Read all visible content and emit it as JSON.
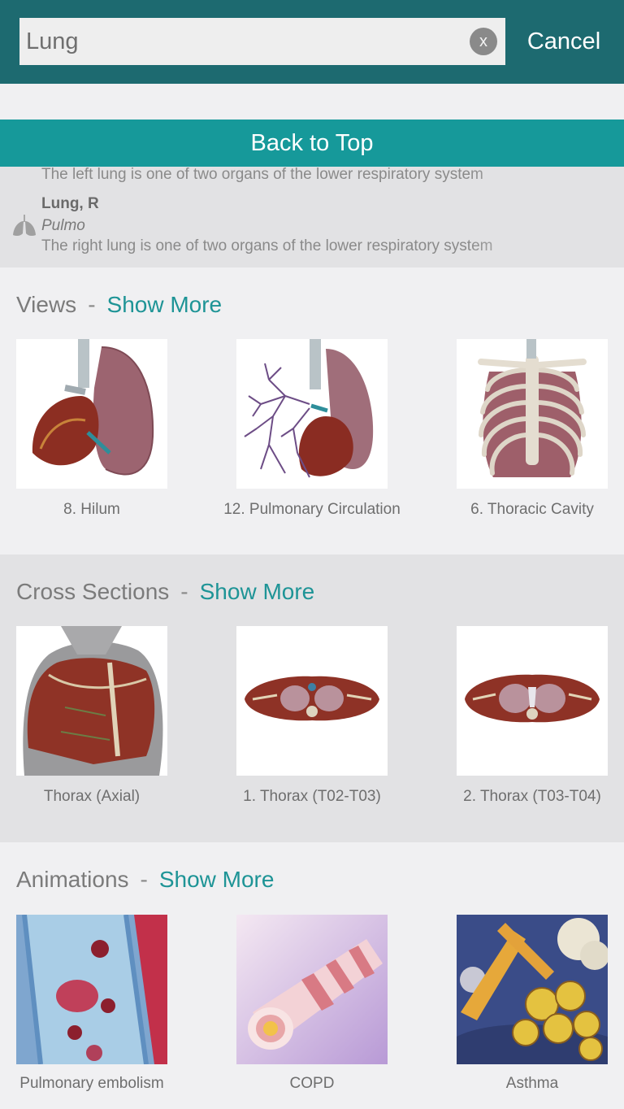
{
  "search": {
    "value": "Lung",
    "clear_label": "x",
    "cancel_label": "Cancel"
  },
  "back_to_top_label": "Back to Top",
  "results": [
    {
      "description": "The left lung is one of two organs of the lower respiratory system"
    },
    {
      "title": "Lung, R",
      "subtitle": "Pulmo",
      "description": "The right lung is one of two organs of the lower respiratory system"
    }
  ],
  "views": {
    "title": "Views",
    "separator": "-",
    "show_more": "Show More",
    "items": [
      {
        "caption": "8. Hilum",
        "icon": "hilum-thumbnail"
      },
      {
        "caption": "12. Pulmonary Circulation",
        "icon": "pulmonary-circulation-thumbnail"
      },
      {
        "caption": "6. Thoracic Cavity",
        "icon": "thoracic-cavity-thumbnail"
      }
    ]
  },
  "cross_sections": {
    "title": "Cross Sections",
    "separator": "-",
    "show_more": "Show More",
    "items": [
      {
        "caption": "Thorax (Axial)",
        "icon": "thorax-axial-thumbnail"
      },
      {
        "caption": "1. Thorax (T02-T03)",
        "icon": "thorax-section-thumbnail"
      },
      {
        "caption": "2. Thorax (T03-T04)",
        "icon": "thorax-section-thumbnail"
      }
    ]
  },
  "animations": {
    "title": "Animations",
    "separator": "-",
    "show_more": "Show More",
    "items": [
      {
        "caption": "Pulmonary embolism",
        "icon": "embolism-thumbnail"
      },
      {
        "caption": "COPD",
        "icon": "copd-thumbnail"
      },
      {
        "caption": "Asthma",
        "icon": "asthma-thumbnail"
      }
    ]
  },
  "colors": {
    "header": "#1d6a70",
    "accent": "#16999a",
    "link": "#1e9496"
  }
}
